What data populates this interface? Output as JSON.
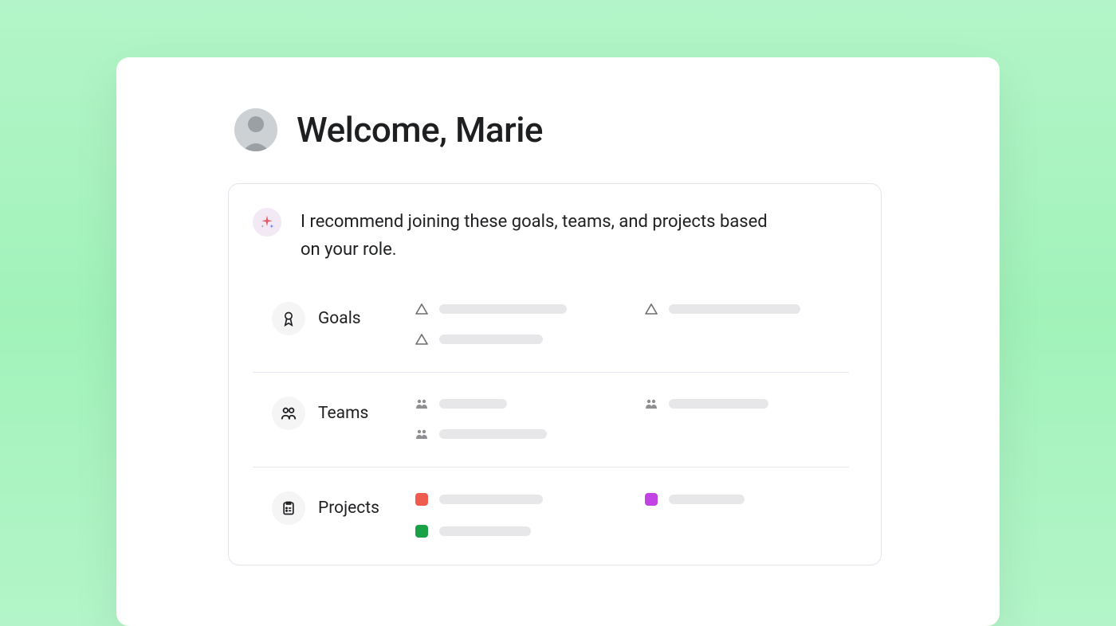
{
  "header": {
    "greeting": "Welcome, Marie"
  },
  "recommendation": {
    "text": "I recommend joining these goals, teams, and projects based on your role."
  },
  "sections": {
    "goals": {
      "label": "Goals"
    },
    "teams": {
      "label": "Teams"
    },
    "projects": {
      "label": "Projects"
    }
  },
  "colors": {
    "project_red": "#f05b4f",
    "project_purple": "#c342e3",
    "project_green": "#18a147"
  }
}
